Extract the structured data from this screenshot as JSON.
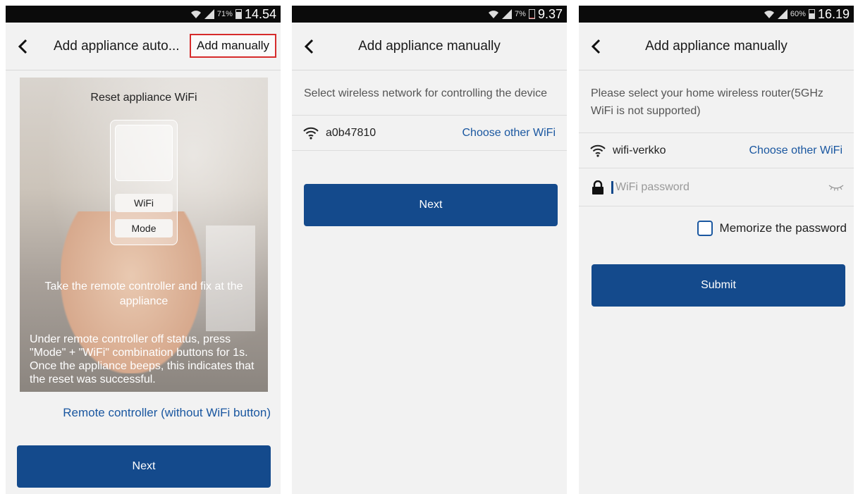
{
  "screens": [
    {
      "status": {
        "battery": "71%",
        "time": "14.54"
      },
      "title": "Add appliance auto...",
      "add_manually": "Add manually",
      "illustration": {
        "title": "Reset appliance WiFi",
        "remote_buttons": [
          "WiFi",
          "Mode"
        ],
        "instruction1": "Take the remote controller and fix at the appliance",
        "instruction2": "Under remote controller off status, press \"Mode\" + \"WiFi\" combination buttons for 1s. Once the appliance beeps, this indicates that the reset was successful."
      },
      "remote_link": "Remote controller (without WiFi button)",
      "next": "Next"
    },
    {
      "status": {
        "battery": "7%",
        "time": "9.37"
      },
      "title": "Add appliance manually",
      "description": "Select wireless network for controlling the device",
      "ssid": "a0b47810",
      "choose_other": "Choose other WiFi",
      "next": "Next"
    },
    {
      "status": {
        "battery": "60%",
        "time": "16.19"
      },
      "title": "Add appliance manually",
      "description": "Please select your home wireless router(5GHz WiFi is not supported)",
      "ssid": "wifi-verkko",
      "choose_other": "Choose other WiFi",
      "password_placeholder": "WiFi password",
      "memorize": "Memorize the password",
      "submit": "Submit"
    }
  ],
  "colors": {
    "accent": "#144a8c",
    "link": "#1a57a0",
    "highlight_box": "#d62b2b"
  },
  "icons": [
    "back-chevron-icon",
    "wifi-icon",
    "lock-icon",
    "eye-closed-icon",
    "signal-icon",
    "battery-icon"
  ]
}
